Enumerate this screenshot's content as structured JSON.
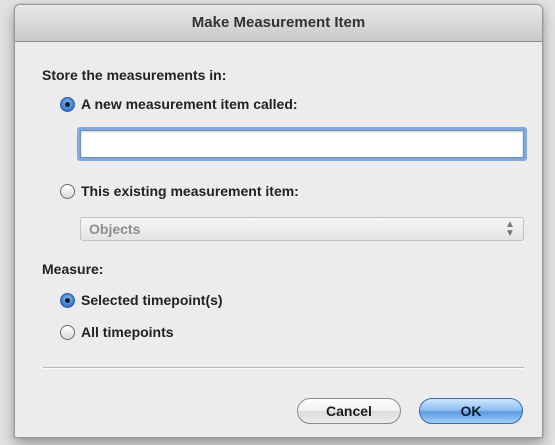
{
  "window": {
    "title": "Make Measurement Item"
  },
  "store": {
    "label": "Store the measurements in:",
    "new_item_label": "A new measurement item called:",
    "new_item_value": "",
    "new_item_selected": true,
    "existing_item_label": "This existing measurement item:",
    "existing_item_selected": false,
    "existing_item_value": "Objects"
  },
  "measure": {
    "label": "Measure:",
    "selected_label": "Selected timepoint(s)",
    "selected_checked": true,
    "all_label": "All timepoints",
    "all_checked": false
  },
  "buttons": {
    "cancel": "Cancel",
    "ok": "OK"
  },
  "colors": {
    "accent": "#5d9ae0",
    "focus_ring": "#7fa9df"
  }
}
